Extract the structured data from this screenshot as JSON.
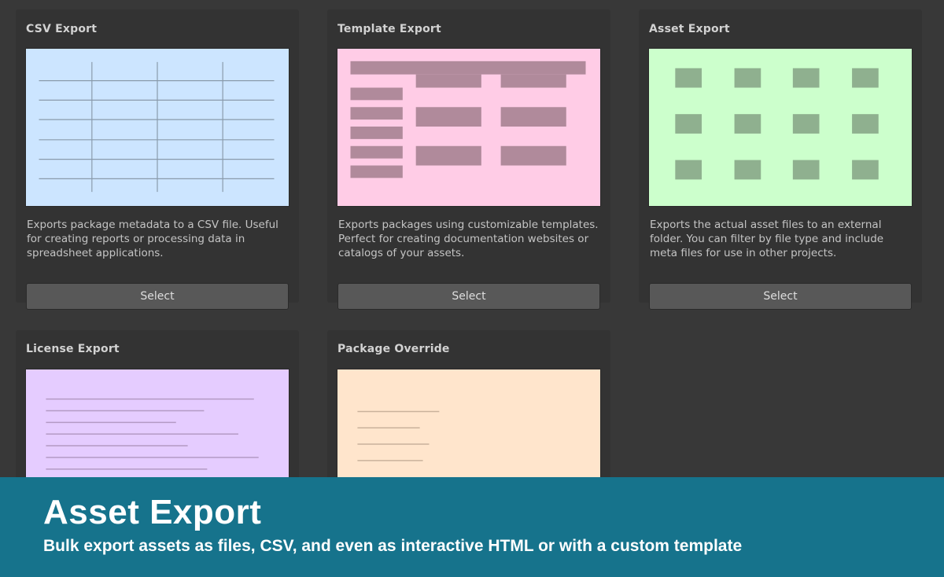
{
  "cards": [
    {
      "title": "CSV Export",
      "description": "Exports package metadata to a CSV file. Useful for creating reports or processing data in spreadsheet applications.",
      "button": "Select",
      "preview_color": "#cce5ff"
    },
    {
      "title": "Template Export",
      "description": "Exports packages using customizable templates. Perfect for creating documentation websites or catalogs of your assets.",
      "button": "Select",
      "preview_color": "#ffcce6"
    },
    {
      "title": "Asset Export",
      "description": "Exports the actual asset files to an external folder. You can filter by file type and include meta files for use in other projects.",
      "button": "Select",
      "preview_color": "#ccffcc"
    },
    {
      "title": "License Export",
      "preview_color": "#e5ccff"
    },
    {
      "title": "Package Override",
      "preview_color": "#ffe5cc"
    }
  ],
  "banner": {
    "title": "Asset Export",
    "subtitle": "Bulk export assets as files, CSV, and even as interactive HTML or with a custom template",
    "color": "#16738c"
  }
}
